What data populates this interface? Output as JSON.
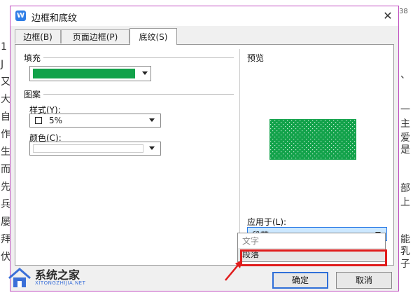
{
  "dialog": {
    "title": "边框和底纹",
    "app_icon_letter": "W",
    "close_glyph": "✕"
  },
  "tabs": [
    {
      "label": "边框(B)"
    },
    {
      "label": "页面边框(P)"
    },
    {
      "label": "底纹(S)",
      "active": true
    }
  ],
  "fill": {
    "heading": "填充",
    "color": "#12a24a"
  },
  "pattern": {
    "heading": "图案",
    "style_label": "样式(Y):",
    "style_value": "5%",
    "color_label": "颜色(C):",
    "color_value": "#ffffff"
  },
  "preview": {
    "heading": "预览",
    "color": "#12a24a"
  },
  "apply_to": {
    "label": "应用于(L):",
    "value": "段落",
    "options": [
      "文字",
      "段落"
    ]
  },
  "buttons": {
    "ok": "确定",
    "cancel": "取消"
  },
  "watermark": {
    "name": "系统之家",
    "url": "XITONGZHIJIA.NET"
  },
  "background_text": {
    "right_top": "38",
    "right_chars": [
      "、",
      "一",
      "主",
      "爱",
      "是",
      "部",
      "上",
      "能",
      "乳",
      "子"
    ],
    "left_chars": [
      "1",
      "J",
      "又",
      "大",
      "自",
      "作",
      "生",
      "而",
      "先",
      "兵",
      "屡",
      "拜",
      "伏"
    ]
  },
  "colors": {
    "accent_border": "#c04ec0",
    "highlight_red": "#e01c1c",
    "green_fill": "#12a24a",
    "selected_blue": "#cce8ff"
  }
}
